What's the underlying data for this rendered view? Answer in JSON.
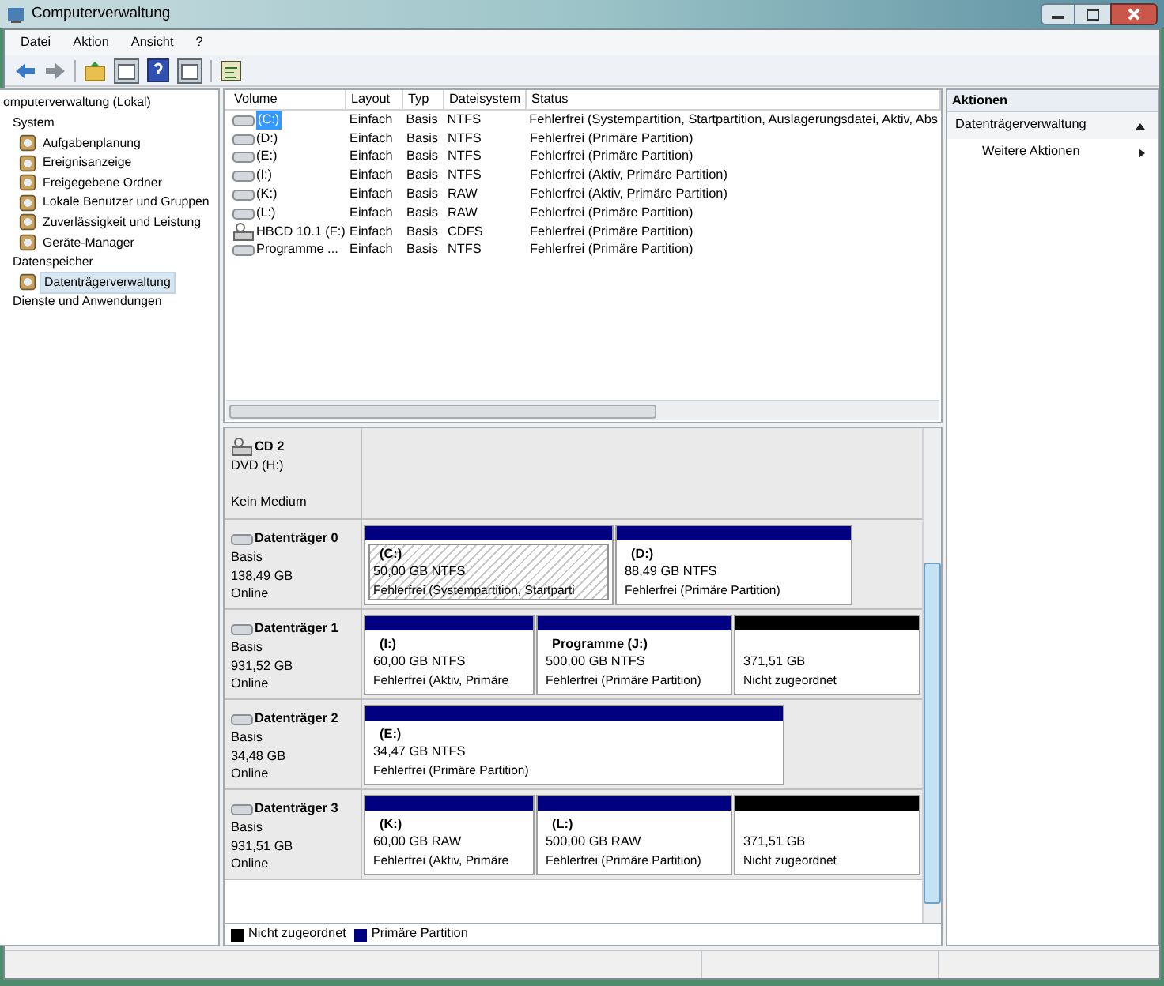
{
  "window": {
    "title": "Computerverwaltung"
  },
  "menu": [
    "Datei",
    "Aktion",
    "Ansicht",
    "?"
  ],
  "tree": [
    {
      "label": "omputerverwaltung (Lokal)",
      "selected": false,
      "children": [
        {
          "label": "System",
          "selected": false,
          "children": [
            {
              "label": "Aufgabenplanung",
              "selected": false
            },
            {
              "label": "Ereignisanzeige",
              "selected": false
            },
            {
              "label": "Freigegebene Ordner",
              "selected": false
            },
            {
              "label": "Lokale Benutzer und Gruppen",
              "selected": false
            },
            {
              "label": "Zuverlässigkeit und Leistung",
              "selected": false
            },
            {
              "label": "Geräte-Manager",
              "selected": false
            }
          ]
        },
        {
          "label": "Datenspeicher",
          "selected": false,
          "children": [
            {
              "label": "Datenträgerverwaltung",
              "selected": true
            }
          ]
        },
        {
          "label": "Dienste und Anwendungen",
          "selected": false
        }
      ]
    }
  ],
  "table": {
    "columns": [
      "Volume",
      "Layout",
      "Typ",
      "Dateisystem",
      "Status"
    ],
    "rows": [
      {
        "selected": true,
        "kind": "disk",
        "cells": [
          "(C:)",
          "Einfach",
          "Basis",
          "NTFS",
          "Fehlerfrei (Systempartition, Startpartition, Auslagerungsdatei, Aktiv, Abs"
        ]
      },
      {
        "selected": false,
        "kind": "disk",
        "cells": [
          "(D:)",
          "Einfach",
          "Basis",
          "NTFS",
          "Fehlerfrei (Primäre Partition)"
        ]
      },
      {
        "selected": false,
        "kind": "disk",
        "cells": [
          "(E:)",
          "Einfach",
          "Basis",
          "NTFS",
          "Fehlerfrei (Primäre Partition)"
        ]
      },
      {
        "selected": false,
        "kind": "disk",
        "cells": [
          "(I:)",
          "Einfach",
          "Basis",
          "NTFS",
          "Fehlerfrei (Aktiv, Primäre Partition)"
        ]
      },
      {
        "selected": false,
        "kind": "disk",
        "cells": [
          "(K:)",
          "Einfach",
          "Basis",
          "RAW",
          "Fehlerfrei (Aktiv, Primäre Partition)"
        ]
      },
      {
        "selected": false,
        "kind": "disk",
        "cells": [
          "(L:)",
          "Einfach",
          "Basis",
          "RAW",
          "Fehlerfrei (Primäre Partition)"
        ]
      },
      {
        "selected": false,
        "kind": "cd",
        "cells": [
          "HBCD 10.1 (F:)",
          "Einfach",
          "Basis",
          "CDFS",
          "Fehlerfrei (Primäre Partition)"
        ]
      },
      {
        "selected": false,
        "kind": "disk",
        "cells": [
          "Programme ...",
          "Einfach",
          "Basis",
          "NTFS",
          "Fehlerfrei (Primäre Partition)"
        ]
      }
    ]
  },
  "disks": [
    {
      "kind": "cd",
      "name": "CD 2",
      "lines": [
        "DVD (H:)",
        "Kein Medium"
      ]
    },
    {
      "kind": "disk",
      "name": "Datenträger 0",
      "lines": [
        "Basis",
        "138,49 GB",
        "Online"
      ],
      "partitions": [
        {
          "kind": "primary",
          "selected": true,
          "label": "(C:)",
          "size": "50,00 GB NTFS",
          "status": "Fehlerfrei (Systempartition, Startparti"
        },
        {
          "kind": "primary",
          "selected": false,
          "label": "(D:)",
          "size": "88,49 GB NTFS",
          "status": "Fehlerfrei (Primäre Partition)"
        }
      ]
    },
    {
      "kind": "disk",
      "name": "Datenträger 1",
      "lines": [
        "Basis",
        "931,52 GB",
        "Online"
      ],
      "partitions": [
        {
          "kind": "primary",
          "selected": false,
          "label": "(I:)",
          "size": "60,00 GB NTFS",
          "status": "Fehlerfrei (Aktiv, Primäre"
        },
        {
          "kind": "primary",
          "selected": false,
          "label": "Programme  (J:)",
          "size": "500,00 GB NTFS",
          "status": "Fehlerfrei (Primäre Partition)"
        },
        {
          "kind": "unallocated",
          "selected": false,
          "size": "371,51 GB",
          "status": "Nicht zugeordnet"
        }
      ]
    },
    {
      "kind": "disk",
      "name": "Datenträger 2",
      "lines": [
        "Basis",
        "34,48 GB",
        "Online"
      ],
      "partitions": [
        {
          "kind": "primary",
          "selected": false,
          "label": "(E:)",
          "size": "34,47 GB NTFS",
          "status": "Fehlerfrei (Primäre Partition)"
        }
      ]
    },
    {
      "kind": "disk",
      "name": "Datenträger 3",
      "lines": [
        "Basis",
        "931,51 GB",
        "Online"
      ],
      "partitions": [
        {
          "kind": "primary",
          "selected": false,
          "label": "(K:)",
          "size": "60,00 GB RAW",
          "status": "Fehlerfrei (Aktiv, Primäre"
        },
        {
          "kind": "primary",
          "selected": false,
          "label": "(L:)",
          "size": "500,00 GB RAW",
          "status": "Fehlerfrei (Primäre Partition)"
        },
        {
          "kind": "unallocated",
          "selected": false,
          "size": "371,51 GB",
          "status": "Nicht zugeordnet"
        }
      ]
    }
  ],
  "legend": [
    {
      "label": "Nicht zugeordnet",
      "color": "#000000"
    },
    {
      "label": "Primäre Partition",
      "color": "#000080"
    }
  ],
  "actions": {
    "title": "Aktionen",
    "items": [
      {
        "label": "Datenträgerverwaltung",
        "kind": "section"
      },
      {
        "label": "Weitere Aktionen",
        "kind": "submenu"
      }
    ]
  }
}
